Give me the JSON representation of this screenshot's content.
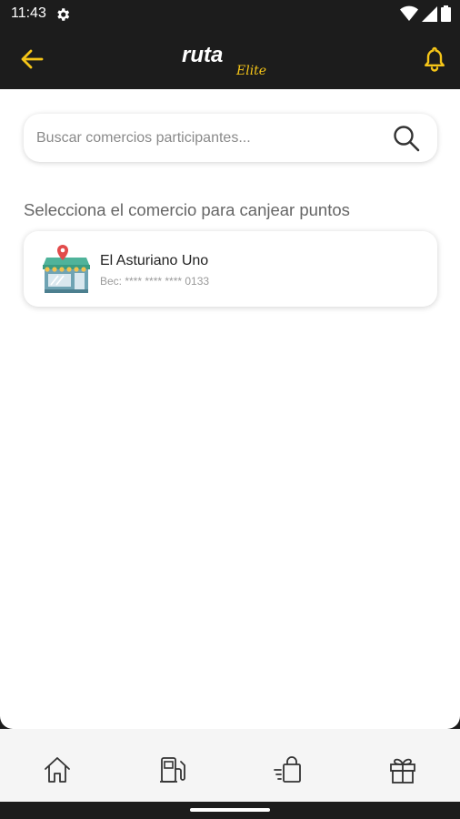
{
  "status_bar": {
    "time": "11:43",
    "gear_icon": "settings-gear-icon",
    "wifi_icon": "wifi-icon",
    "signal_icon": "cell-signal-icon",
    "battery_icon": "battery-icon"
  },
  "app_bar": {
    "back_icon": "arrow-left-icon",
    "logo_main": "ruta",
    "logo_sub": "Elite",
    "notification_icon": "bell-icon",
    "accent_color": "#f5c518"
  },
  "search": {
    "placeholder": "Buscar comercios participantes...",
    "value": "",
    "icon": "search-icon"
  },
  "section": {
    "heading": "Selecciona el comercio para canjear puntos"
  },
  "merchants": [
    {
      "name": "El Asturiano Uno",
      "subtitle": "Bec: **** **** **** 0133",
      "icon": "store-icon"
    }
  ],
  "bottom_nav": {
    "items": [
      {
        "icon": "home-icon"
      },
      {
        "icon": "fuel-pump-icon"
      },
      {
        "icon": "shopping-bag-icon"
      },
      {
        "icon": "gift-icon"
      }
    ]
  }
}
